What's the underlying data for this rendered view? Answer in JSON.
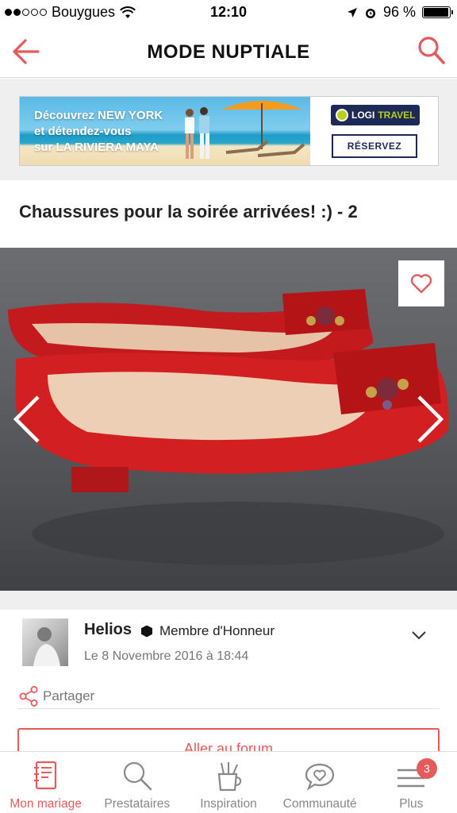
{
  "status_bar": {
    "carrier": "Bouygues",
    "time": "12:10",
    "battery": "96 %",
    "battery_level": 0.96
  },
  "header": {
    "title": "MODE NUPTIALE",
    "back_icon": "back-arrow-icon",
    "search_icon": "search-icon"
  },
  "ad": {
    "text_line1": "Découvrez NEW YORK",
    "text_line2": "et détendez-vous",
    "text_line3": "sur LA RIVIERA MAYA",
    "brand": "LOGITRAVEL",
    "brand_part1": "LOGI",
    "brand_part2": "TRAVEL",
    "cta": "RÉSERVEZ"
  },
  "post": {
    "title": "Chaussures pour la soirée arrivées! :) - 2",
    "author": "Helios",
    "rank": "Membre d'Honneur",
    "date": "Le 8 Novembre 2016 à 18:44",
    "share_label": "Partager",
    "forum_button": "Aller au forum"
  },
  "tabs": [
    {
      "label": "Mon mariage",
      "icon": "notebook-icon",
      "active": true
    },
    {
      "label": "Prestataires",
      "icon": "search-icon",
      "active": false
    },
    {
      "label": "Inspiration",
      "icon": "pencil-cup-icon",
      "active": false
    },
    {
      "label": "Communauté",
      "icon": "chat-heart-icon",
      "active": false
    },
    {
      "label": "Plus",
      "icon": "menu-icon",
      "active": false,
      "badge": "3"
    }
  ],
  "colors": {
    "accent": "#e55b5b",
    "text": "#222222",
    "muted": "#888888",
    "ad_brand": "#1d2a55"
  }
}
